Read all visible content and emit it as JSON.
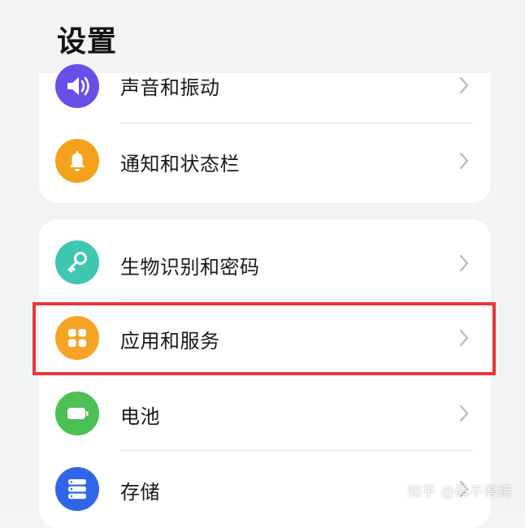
{
  "page": {
    "title": "设置"
  },
  "groups": [
    {
      "items": [
        {
          "label": "声音和振动",
          "icon": "speaker-icon",
          "color": "#6a4ee8"
        },
        {
          "label": "通知和状态栏",
          "icon": "bell-icon",
          "color": "#f4a21b"
        }
      ]
    },
    {
      "items": [
        {
          "label": "生物识别和密码",
          "icon": "key-icon",
          "color": "#40c7b1"
        },
        {
          "label": "应用和服务",
          "icon": "apps-grid-icon",
          "color": "#f5a426",
          "highlighted": true
        },
        {
          "label": "电池",
          "icon": "battery-icon",
          "color": "#4cbf55"
        },
        {
          "label": "存储",
          "icon": "storage-icon",
          "color": "#2f66e9"
        }
      ]
    }
  ],
  "highlight_color": "#e8363b",
  "watermark": "知乎 @码不停蹄"
}
